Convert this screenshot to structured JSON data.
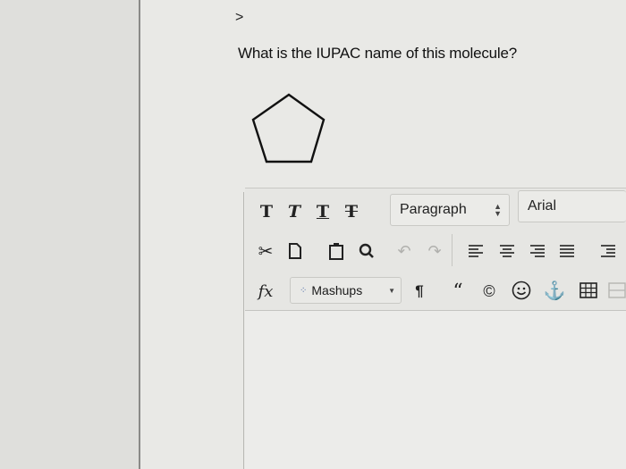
{
  "nav": {
    "caret": ">"
  },
  "question": {
    "text": "What is the IUPAC name of this molecule?"
  },
  "toolbar": {
    "row1": {
      "text_buttons": [
        "T",
        "T",
        "T",
        "T"
      ],
      "format_select": "Paragraph",
      "font_select": "Arial"
    },
    "row2": {
      "icons": [
        "cut-icon",
        "copy-icon",
        "paste-icon",
        "find-icon",
        "undo-icon",
        "redo-icon",
        "align-left-icon",
        "align-center-icon",
        "align-right-icon",
        "align-justify-icon",
        "list-icon"
      ]
    },
    "row3": {
      "formula_label": "fx",
      "mashups_label": "Mashups",
      "pilcrow": "¶",
      "quote": "“",
      "copyright": "©",
      "icons": [
        "formula-icon",
        "pilcrow-icon",
        "quote-icon",
        "copyright-icon",
        "emoji-icon",
        "anchor-icon",
        "table-icon"
      ]
    }
  },
  "colors": {
    "accent": "#4a6aa8",
    "text": "#1a1a1a",
    "background": "#e9e9e6"
  }
}
